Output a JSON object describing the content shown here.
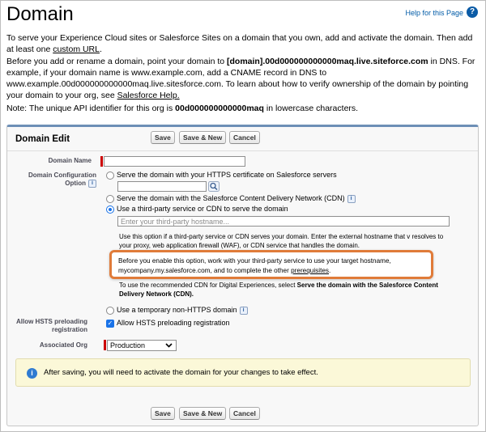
{
  "page": {
    "title": "Domain",
    "help_link": "Help for this Page",
    "help_icon": "question-icon"
  },
  "intro": {
    "p1_text": "To serve your Experience Cloud sites or Salesforce Sites on a domain that you own, add and activate the domain. Then add at least one ",
    "p1_link": "custom URL",
    "p1_end": ".",
    "p2_start": "Before you add or rename a domain, point your domain to ",
    "p2_bold": "[domain].00d000000000000maq.live.siteforce.com",
    "p2_mid": " in DNS. For example, if your domain name is www.example.com, add a CNAME record in DNS to www.example.00d000000000000maq.live.sitesforce.com. To learn about how to verify ownership of the domain by pointing your domain to your org, see ",
    "p2_link": "Salesforce Help.",
    "p3_start": "Note: The unique API identifier for this org is ",
    "p3_bold": "00d000000000000maq",
    "p3_end": " in lowercase characters."
  },
  "panel": {
    "title": "Domain Edit",
    "save": "Save",
    "save_new": "Save & New",
    "cancel": "Cancel"
  },
  "form": {
    "domain_name_label": "Domain Name",
    "domain_name_value": "",
    "config_label_line1": "Domain Configuration",
    "config_label_line2": "Option",
    "opt1": "Serve the domain with your HTTPS certificate on Salesforce servers",
    "opt1_field_value": "",
    "opt2": "Serve the domain with the Salesforce Content Delivery Network (CDN)",
    "opt3": "Use a third-party service or CDN to serve the domain",
    "hostname_placeholder": "Enter your third-party hostname...",
    "opt3_note": "Use this option if a third-party service or CDN serves your domain. Enter the external hostname that v resolves to your proxy, web application firewall (WAF), or CDN service that handles the domain.",
    "callout_text": "Before you enable this option, work with your third-party service to use your target hostname, mycompany.my.salesforce.com, and to complete the other ",
    "callout_link": "prerequisites",
    "callout_end": ".",
    "cdn_note_start": "To use the recommended CDN for Digital Experiences, select ",
    "cdn_note_bold": "Serve the domain with the Salesforce Content Delivery Network (CDN).",
    "opt4": "Use a temporary non-HTTPS domain",
    "hsts_label_line1": "Allow HSTS preloading",
    "hsts_label_line2": "registration",
    "hsts_checkbox": "Allow HSTS preloading registration",
    "hsts_checked": true,
    "org_label": "Associated Org",
    "org_value": "Production",
    "selected_option": "opt3"
  },
  "alert": {
    "icon": "info-icon",
    "text": "After saving, you will need to activate the domain for your changes to take effect."
  },
  "colors": {
    "accent": "#1a73e8",
    "callout_border": "#e07b39",
    "alert_bg": "#fbf8d8",
    "panel_top_border": "#6d8fb6"
  }
}
